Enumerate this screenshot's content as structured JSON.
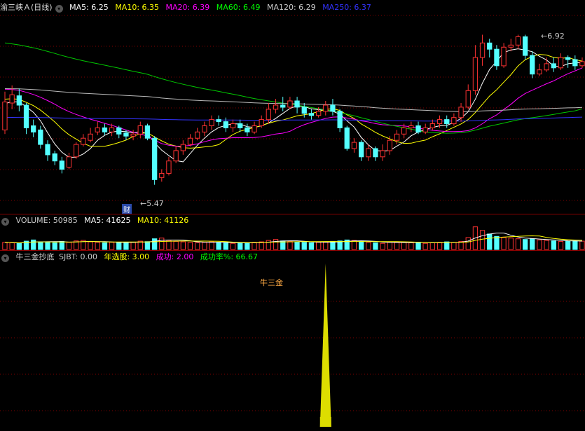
{
  "main_legend": {
    "title": "渝三峡Ａ(日线)",
    "items": [
      {
        "label": "MA5: 6.25",
        "color": "#ffffff"
      },
      {
        "label": "MA10: 6.35",
        "color": "#ffff00"
      },
      {
        "label": "MA20: 6.39",
        "color": "#ff00ff"
      },
      {
        "label": "MA60: 6.49",
        "color": "#00ff00"
      },
      {
        "label": "MA120: 6.29",
        "color": "#cccccc"
      },
      {
        "label": "MA250: 6.37",
        "color": "#3333ff"
      }
    ]
  },
  "annotations": {
    "high": "6.92",
    "low": "5.47",
    "badge": "财"
  },
  "volume_legend": [
    {
      "label": "VOLUME: 50985",
      "color": "#cccccc"
    },
    {
      "label": "MA5: 41625",
      "color": "#ffffff"
    },
    {
      "label": "MA10: 41126",
      "color": "#ffff00"
    }
  ],
  "indicator_legend": [
    {
      "label": "牛三金抄底",
      "color": "#cccccc"
    },
    {
      "label": "SJBT: 0.00",
      "color": "#cccccc"
    },
    {
      "label": "年选股: 3.00",
      "color": "#ffff00"
    },
    {
      "label": "成功: 2.00",
      "color": "#ff00ff"
    },
    {
      "label": "成功率%: 66.67",
      "color": "#00ff00"
    }
  ],
  "signal_label": "牛三金",
  "colors": {
    "up": "#ff3232",
    "down": "#54ffff",
    "signal": "#dddd00",
    "grid": "#800000"
  },
  "candles": [
    [
      6.0,
      6.27,
      6.37,
      5.96
    ],
    [
      6.26,
      6.34,
      6.43,
      6.2
    ],
    [
      6.33,
      6.24,
      6.4,
      6.18
    ],
    [
      6.24,
      6.02,
      6.26,
      5.96
    ],
    [
      6.04,
      5.98,
      6.1,
      5.93
    ],
    [
      6.0,
      5.86,
      6.04,
      5.82
    ],
    [
      5.86,
      5.76,
      5.9,
      5.7
    ],
    [
      5.77,
      5.7,
      5.8,
      5.66
    ],
    [
      5.7,
      5.62,
      5.74,
      5.58
    ],
    [
      5.64,
      5.74,
      5.78,
      5.62
    ],
    [
      5.74,
      5.86,
      5.88,
      5.72
    ],
    [
      5.86,
      5.92,
      5.96,
      5.84
    ],
    [
      5.9,
      5.96,
      6.02,
      5.88
    ],
    [
      5.98,
      6.02,
      6.08,
      5.95
    ],
    [
      6.02,
      5.98,
      6.06,
      5.95
    ],
    [
      5.98,
      6.02,
      6.06,
      5.94
    ],
    [
      6.02,
      5.96,
      6.04,
      5.92
    ],
    [
      5.97,
      5.94,
      6.0,
      5.9
    ],
    [
      5.94,
      5.96,
      6.0,
      5.9
    ],
    [
      5.96,
      6.04,
      6.08,
      5.92
    ],
    [
      6.04,
      5.92,
      6.06,
      5.9
    ],
    [
      5.92,
      5.52,
      5.94,
      5.47
    ],
    [
      5.54,
      5.58,
      5.62,
      5.5
    ],
    [
      5.58,
      5.7,
      5.74,
      5.56
    ],
    [
      5.7,
      5.8,
      5.84,
      5.68
    ],
    [
      5.8,
      5.86,
      5.9,
      5.76
    ],
    [
      5.86,
      5.92,
      5.96,
      5.84
    ],
    [
      5.92,
      5.98,
      6.02,
      5.9
    ],
    [
      5.98,
      6.04,
      6.08,
      5.94
    ],
    [
      6.04,
      6.1,
      6.14,
      6.0
    ],
    [
      6.1,
      6.08,
      6.14,
      6.04
    ],
    [
      6.08,
      6.02,
      6.12,
      5.98
    ],
    [
      6.02,
      6.06,
      6.1,
      5.98
    ],
    [
      6.06,
      6.02,
      6.1,
      5.98
    ],
    [
      6.02,
      5.98,
      6.06,
      5.94
    ],
    [
      5.98,
      6.04,
      6.08,
      5.96
    ],
    [
      6.04,
      6.1,
      6.14,
      6.02
    ],
    [
      6.1,
      6.2,
      6.26,
      6.06
    ],
    [
      6.2,
      6.24,
      6.3,
      6.16
    ],
    [
      6.24,
      6.22,
      6.32,
      6.18
    ],
    [
      6.22,
      6.28,
      6.32,
      6.2
    ],
    [
      6.28,
      6.22,
      6.32,
      6.16
    ],
    [
      6.22,
      6.16,
      6.26,
      6.12
    ],
    [
      6.16,
      6.14,
      6.2,
      6.1
    ],
    [
      6.14,
      6.18,
      6.22,
      6.12
    ],
    [
      6.18,
      6.24,
      6.28,
      6.14
    ],
    [
      6.24,
      6.18,
      6.3,
      6.14
    ],
    [
      6.18,
      6.02,
      6.2,
      5.98
    ],
    [
      6.02,
      5.82,
      6.04,
      5.8
    ],
    [
      5.82,
      5.88,
      5.92,
      5.78
    ],
    [
      5.88,
      5.74,
      5.9,
      5.7
    ],
    [
      5.74,
      5.82,
      5.86,
      5.7
    ],
    [
      5.82,
      5.74,
      5.84,
      5.7
    ],
    [
      5.74,
      5.8,
      5.86,
      5.7
    ],
    [
      5.8,
      5.9,
      5.94,
      5.76
    ],
    [
      5.9,
      5.96,
      6.0,
      5.86
    ],
    [
      5.96,
      6.02,
      6.06,
      5.92
    ],
    [
      6.02,
      6.04,
      6.08,
      5.98
    ],
    [
      6.04,
      5.98,
      6.08,
      5.96
    ],
    [
      5.98,
      6.02,
      6.06,
      5.96
    ],
    [
      6.02,
      6.06,
      6.1,
      6.0
    ],
    [
      6.06,
      6.1,
      6.14,
      6.02
    ],
    [
      6.1,
      6.06,
      6.14,
      6.02
    ],
    [
      6.06,
      6.12,
      6.16,
      6.04
    ],
    [
      6.12,
      6.22,
      6.26,
      6.08
    ],
    [
      6.22,
      6.38,
      6.44,
      6.2
    ],
    [
      6.38,
      6.7,
      6.82,
      6.34
    ],
    [
      6.7,
      6.84,
      6.92,
      6.62
    ],
    [
      6.84,
      6.78,
      6.88,
      6.7
    ],
    [
      6.78,
      6.62,
      6.82,
      6.58
    ],
    [
      6.62,
      6.8,
      6.84,
      6.6
    ],
    [
      6.8,
      6.82,
      6.88,
      6.76
    ],
    [
      6.82,
      6.9,
      6.92,
      6.78
    ],
    [
      6.9,
      6.72,
      6.92,
      6.68
    ],
    [
      6.72,
      6.54,
      6.76,
      6.5
    ],
    [
      6.54,
      6.58,
      6.64,
      6.52
    ],
    [
      6.58,
      6.64,
      6.7,
      6.56
    ],
    [
      6.64,
      6.6,
      6.7,
      6.56
    ],
    [
      6.6,
      6.7,
      6.74,
      6.58
    ],
    [
      6.7,
      6.68,
      6.72,
      6.6
    ],
    [
      6.68,
      6.62,
      6.72,
      6.58
    ],
    [
      6.62,
      6.66,
      6.7,
      6.6
    ]
  ],
  "volume": [
    30,
    28,
    26,
    35,
    40,
    32,
    30,
    28,
    34,
    30,
    36,
    38,
    32,
    30,
    28,
    30,
    29,
    31,
    30,
    35,
    33,
    45,
    48,
    38,
    34,
    32,
    30,
    28,
    30,
    32,
    30,
    28,
    26,
    28,
    27,
    30,
    32,
    38,
    42,
    36,
    34,
    32,
    30,
    28,
    30,
    32,
    34,
    36,
    40,
    38,
    34,
    30,
    28,
    26,
    30,
    32,
    30,
    28,
    30,
    26,
    28,
    30,
    32,
    30,
    34,
    50,
    95,
    80,
    65,
    55,
    50,
    48,
    45,
    42,
    44,
    40,
    38,
    36,
    34,
    35,
    36,
    35
  ],
  "signal_value": 1.0,
  "signal_index": 45
}
